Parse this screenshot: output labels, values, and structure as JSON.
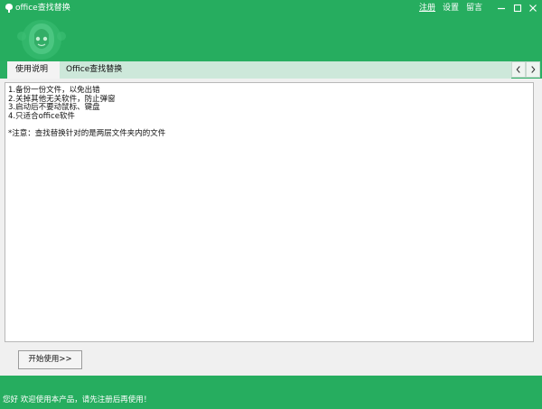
{
  "window": {
    "title": "office查找替换",
    "links": {
      "register": "注册",
      "settings": "设置",
      "feedback": "留言"
    }
  },
  "tabs": [
    {
      "label": "使用说明",
      "active": true
    },
    {
      "label": "Office查找替换",
      "active": false
    }
  ],
  "instructions": {
    "lines": [
      "1.备份一份文件，以免出错",
      "2.关掉其他无关软件，防止弹窗",
      "3.启动后不要动鼠标、键盘",
      "4.只适合office软件"
    ],
    "note": "*注意：查找替换针对的是两层文件夹内的文件"
  },
  "start_button": "开始使用>>",
  "status": "您好 欢迎使用本产品，请先注册后再使用！",
  "colors": {
    "brand_green": "#26ad5f",
    "tab_inactive": "#cde8da"
  },
  "icons": [
    "app-icon",
    "mascot-logo",
    "minimize-icon",
    "maximize-icon",
    "close-icon",
    "chevron-left-icon",
    "chevron-right-icon"
  ]
}
